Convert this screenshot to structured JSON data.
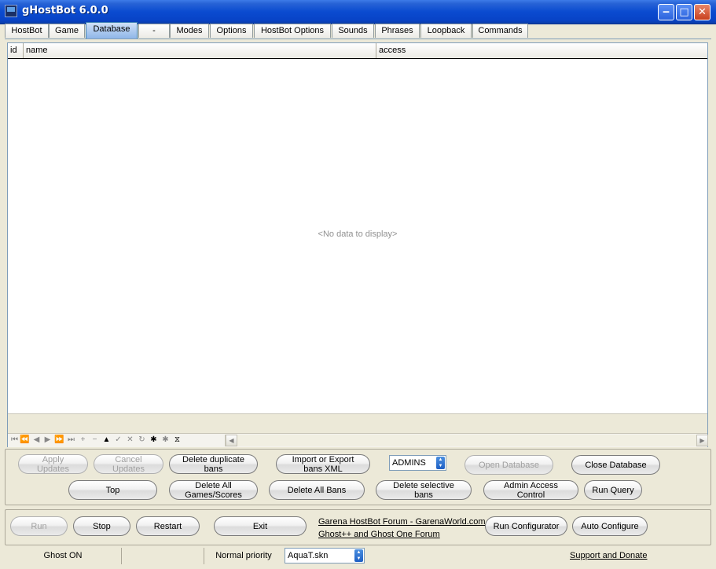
{
  "window": {
    "title": "gHostBot  6.0.0",
    "icons": {
      "minimize": "‒",
      "maximize": "□",
      "close": "✕"
    }
  },
  "tabs": [
    "HostBot",
    "Game",
    "Database",
    "-",
    "Modes",
    "Options",
    "HostBot Options",
    "Sounds",
    "Phrases",
    "Loopback",
    "Commands"
  ],
  "active_tab": "Database",
  "grid": {
    "columns": [
      "id",
      "name",
      "access"
    ],
    "empty_text": "<No data to display>"
  },
  "navigator": {
    "icons": [
      "⏮",
      "⏪",
      "◀",
      "▶",
      "⏩",
      "⏭",
      "+",
      "−",
      "▲",
      "✓",
      "✕",
      "↻",
      "✱",
      "✱",
      "⧖"
    ]
  },
  "scroll": {
    "left": "◀",
    "right": "▶"
  },
  "db_panel": {
    "apply_updates": [
      "Apply",
      "Updates"
    ],
    "cancel_updates": [
      "Cancel",
      "Updates"
    ],
    "delete_duplicate_bans": [
      "Delete duplicate",
      "bans"
    ],
    "import_export_bans": [
      "Import or Export",
      "bans XML"
    ],
    "admins_combo": "ADMINS",
    "open_database": "Open Database",
    "close_database": "Close Database",
    "top": "Top",
    "delete_all_games": [
      "Delete All",
      "Games/Scores"
    ],
    "delete_all_bans": "Delete All Bans",
    "delete_selective_bans": [
      "Delete selective",
      "bans"
    ],
    "admin_access_control": [
      "Admin Access",
      "Control"
    ],
    "run_query": "Run Query"
  },
  "control_panel": {
    "run": "Run",
    "stop": "Stop",
    "restart": "Restart",
    "exit": "Exit",
    "link_garena": "Garena HostBot Forum - GarenaWorld.com",
    "link_ghost": "Ghost++ and Ghost One Forum",
    "run_configurator": "Run Configurator",
    "auto_configure": "Auto Configure"
  },
  "statusbar": {
    "ghost_status": "Ghost ON",
    "priority": "Normal priority",
    "skin": "AquaT.skn",
    "support": "Support and Donate"
  }
}
